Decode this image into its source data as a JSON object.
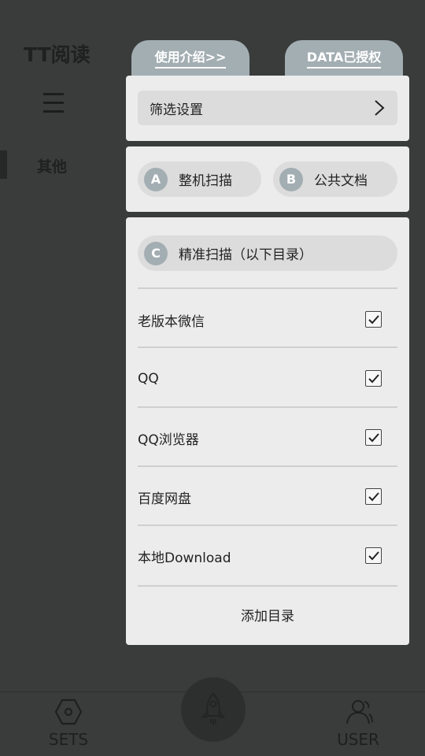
{
  "app": {
    "title": "TT阅读",
    "side_other": "其他",
    "tab_intro": "使用介绍>>",
    "tab_data": "DATA已授权"
  },
  "popup": {
    "filter_label": "筛选设置",
    "scan_a": {
      "badge": "A",
      "label": "整机扫描"
    },
    "scan_b": {
      "badge": "B",
      "label": "公共文档"
    },
    "scan_c": {
      "badge": "C",
      "label": "精准扫描（以下目录）"
    },
    "directories": [
      {
        "label": "老版本微信",
        "checked": true
      },
      {
        "label": "QQ",
        "checked": true
      },
      {
        "label": "QQ浏览器",
        "checked": true
      },
      {
        "label": "百度网盘",
        "checked": true
      },
      {
        "label": "本地Download",
        "checked": true
      }
    ],
    "add_directory": "添加目录"
  },
  "nav": {
    "sets": "SETS",
    "user": "USER"
  },
  "colors": {
    "accent": "#a3aeb3",
    "card": "#ececec",
    "pill": "#dcdcdc",
    "backdrop": "#3a3c3c"
  },
  "icons": {
    "menu": "menu-icon",
    "chevron": "chevron-right-icon",
    "check": "checkmark-icon",
    "sets": "hexagon-nut-icon",
    "rocket": "rocket-icon",
    "user": "users-icon"
  }
}
